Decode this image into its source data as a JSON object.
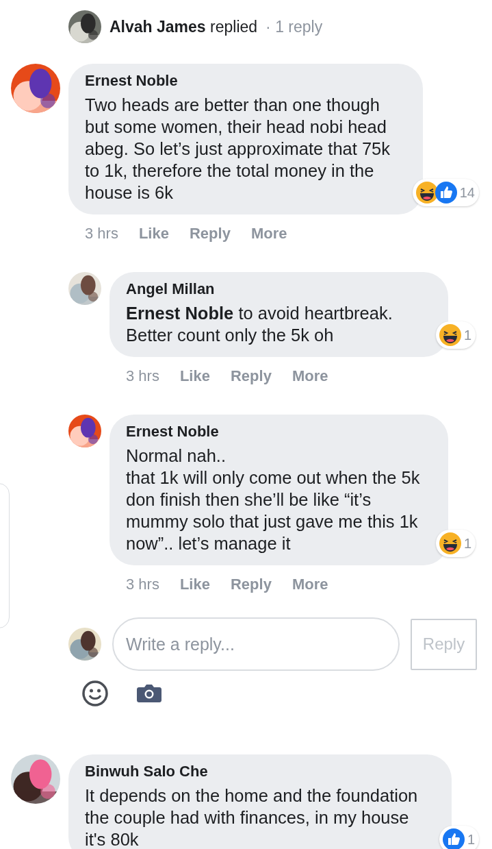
{
  "thread_header": {
    "author": "Alvah James",
    "action": "replied",
    "separator": "·",
    "count": "1 reply"
  },
  "comments": [
    {
      "author": "Ernest Noble",
      "text": "Two heads are better than one though but some women, their head nobi head abeg. So let’s just approximate that 75k to 1k, therefore the total money in the house is 6k",
      "reactions": [
        {
          "kind": "haha"
        },
        {
          "kind": "like"
        }
      ],
      "reaction_count": "14",
      "time": "3 hrs",
      "actions": [
        "Like",
        "Reply",
        "More"
      ],
      "replies": [
        {
          "author": "Angel Millan",
          "text": "**Ernest Noble** to avoid heartbreak. Better count only the 5k oh",
          "reactions": [
            {
              "kind": "haha"
            }
          ],
          "reaction_count": "1",
          "time": "3 hrs",
          "actions": [
            "Like",
            "Reply",
            "More"
          ]
        },
        {
          "author": "Ernest Noble",
          "text": "Normal nah..\nthat 1k will only come out when the 5k don finish then she’ll be like “it’s mummy solo that just gave me this 1k now”.. let’s manage it",
          "reactions": [
            {
              "kind": "haha"
            }
          ],
          "reaction_count": "1",
          "time": "3 hrs",
          "actions": [
            "Like",
            "Reply",
            "More"
          ]
        }
      ],
      "reply_box": {
        "placeholder": "Write a reply...",
        "button": "Reply"
      }
    },
    {
      "author": "Binwuh Salo Che",
      "text": "It depends on the home and the foundation the couple had with finances, in my house it's 80k",
      "reactions": [
        {
          "kind": "like"
        }
      ],
      "reaction_count": "1"
    }
  ]
}
